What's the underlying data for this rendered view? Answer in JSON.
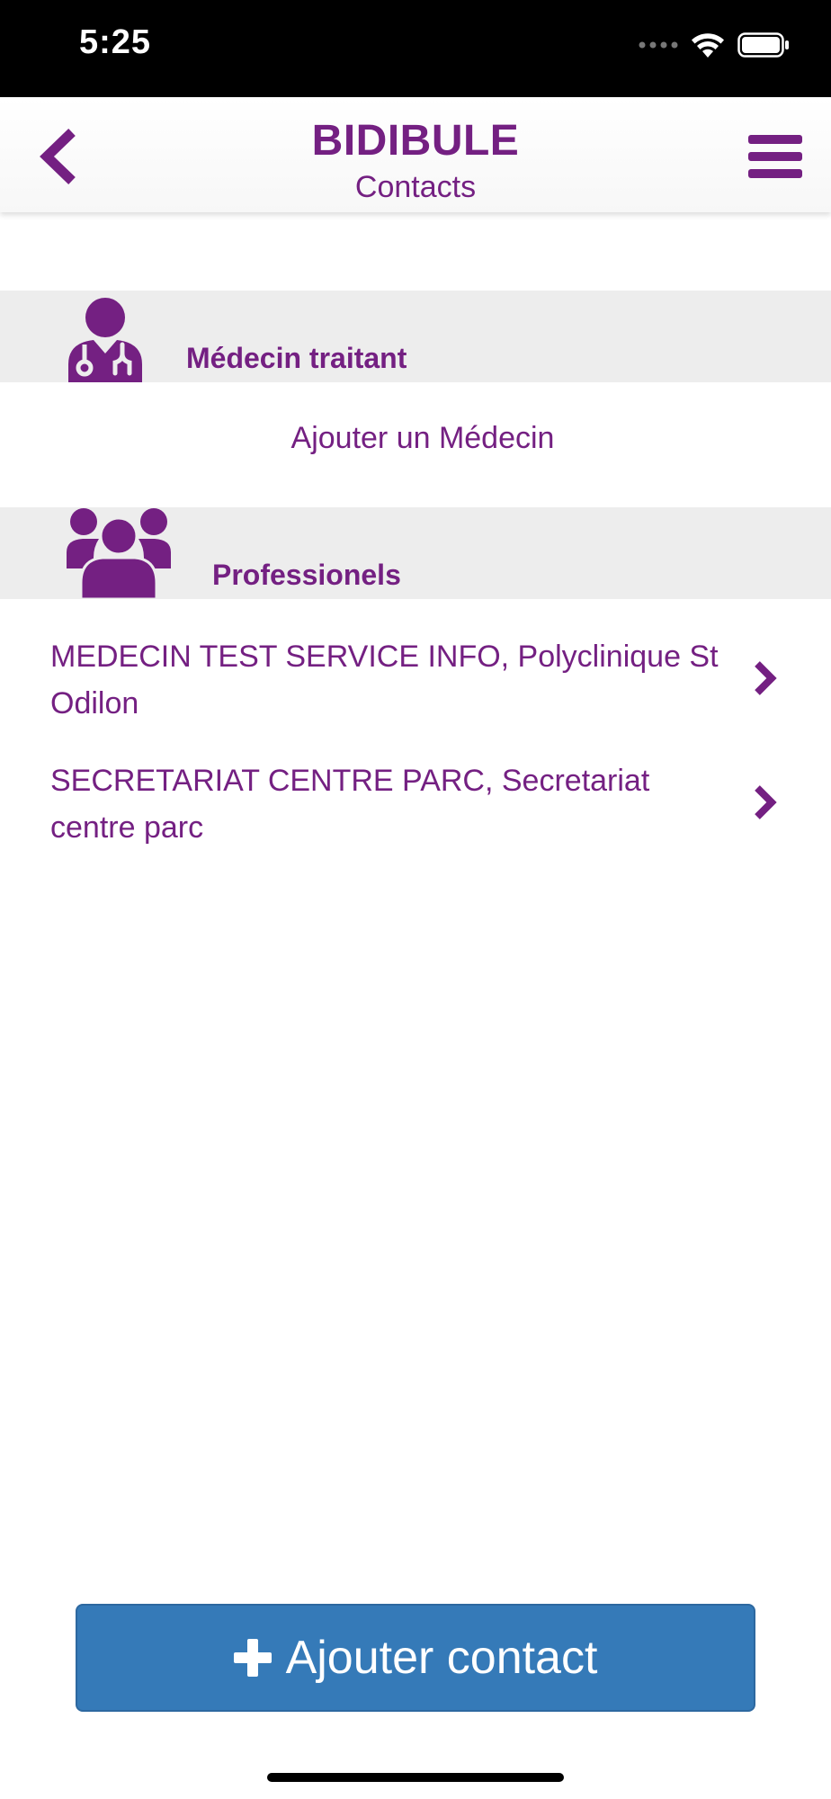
{
  "status_bar": {
    "time": "5:25",
    "icons": [
      "signal-dots-icon",
      "wifi-icon",
      "battery-icon"
    ]
  },
  "nav": {
    "title": "BIDIBULE",
    "subtitle": "Contacts",
    "back_icon": "chevron-left-icon",
    "menu_icon": "hamburger-menu-icon"
  },
  "sections": {
    "doctor": {
      "icon": "doctor-stethoscope-icon",
      "title": "Médecin traitant",
      "add_link": "Ajouter un Médecin"
    },
    "professionals": {
      "icon": "group-users-icon",
      "title": "Professionels",
      "contacts": [
        {
          "label": "MEDECIN TEST SERVICE INFO, Polyclinique St Odilon"
        },
        {
          "label": "SECRETARIAT CENTRE PARC, Secretariat centre parc"
        }
      ]
    }
  },
  "footer": {
    "add_contact_label": "Ajouter contact",
    "add_icon": "plus-icon"
  },
  "colors": {
    "accent": "#742082",
    "button": "#357ab8",
    "section_bg": "#ededed"
  }
}
